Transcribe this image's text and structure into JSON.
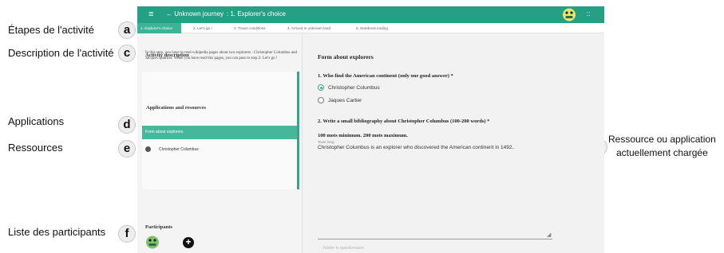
{
  "annotations": {
    "a": {
      "letter": "a",
      "label": "Étapes de l'activité"
    },
    "c": {
      "letter": "c",
      "label": "Description de l'activité"
    },
    "d": {
      "letter": "d",
      "label": "Applications"
    },
    "e": {
      "letter": "e",
      "label": "Ressources"
    },
    "f": {
      "letter": "f",
      "label": "Liste des participants"
    },
    "b": {
      "letter": "b",
      "label_line1": "Ressource ou application",
      "label_line2": "actuellement chargée"
    }
  },
  "topbar": {
    "menu_icon": "≡",
    "back_label": "← Unknown journey",
    "crumb": ": 1. Explorer's choice",
    "apps_icon": "::",
    "accent": "#26a085"
  },
  "steps": [
    {
      "label": "1. Explorer's choice",
      "active": true
    },
    {
      "label": "2. Let's go !",
      "active": false
    },
    {
      "label": "3. Travel conditions",
      "active": false
    },
    {
      "label": "4. Arrived in unknown land",
      "active": false
    },
    {
      "label": "5. Notebook ending",
      "active": false
    }
  ],
  "left": {
    "description_title": "Activity description",
    "description_text": "In this step, you have to read wikipedia pages about two explorers : Christopher Columbus and Jacques Quartier. When you have read this pages, you can pass to step 2: Let's go !",
    "apps_title": "Applications and resources",
    "app_item": "Form about explorers",
    "resource_item": "Christopher Columbus",
    "participants_title": "Participants",
    "add_icon": "+"
  },
  "right": {
    "form_title": "Form about explorers",
    "q1": "1. Who find the American continent (only one good answer) *",
    "option1": "Christopher Columbus",
    "option2": "Jaques Cartier",
    "q2": "2. Write a small bibliography about Christopher Columbus (100-200 words) *",
    "hint": "100 mots minimum. 200 mots maximum.",
    "field_label": "Texte long",
    "answer": "Christopher Columbus is an explorer who discovered the American continent in 1492.",
    "submit": "Valider le questionnaire"
  }
}
